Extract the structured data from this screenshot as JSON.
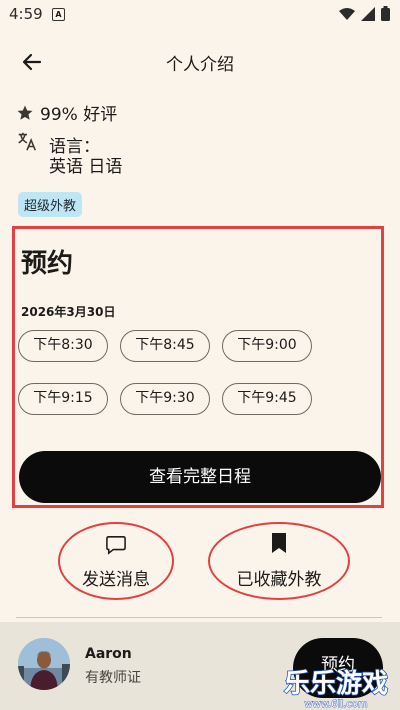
{
  "status": {
    "time": "4:59",
    "notif_glyph": "A"
  },
  "appbar": {
    "title": "个人介绍"
  },
  "rating": {
    "text": "99% 好评"
  },
  "language": {
    "label": "语言：",
    "values": "英语  日语"
  },
  "badge": "超级外教",
  "booking": {
    "heading": "预约",
    "date": "2026年3月30日",
    "slots": [
      "下午8:30",
      "下午8:45",
      "下午9:00",
      "下午9:15",
      "下午9:30",
      "下午9:45"
    ],
    "schedule_label": "查看完整日程"
  },
  "actions": {
    "message": "发送消息",
    "saved": "已收藏外教"
  },
  "teacher": {
    "name": "Aaron",
    "cert": "有教师证",
    "book_label": "预约"
  },
  "watermark": {
    "brand": "乐乐游戏",
    "url": "www.6ll.com"
  },
  "colors": {
    "highlight": "#e2413f",
    "badge_bg": "#bfe6f4",
    "background": "#fbf4ea"
  },
  "icons": [
    "back-arrow-icon",
    "star-icon",
    "translate-icon",
    "chat-bubble-icon",
    "bookmark-icon",
    "wifi-icon",
    "signal-icon",
    "battery-icon"
  ]
}
